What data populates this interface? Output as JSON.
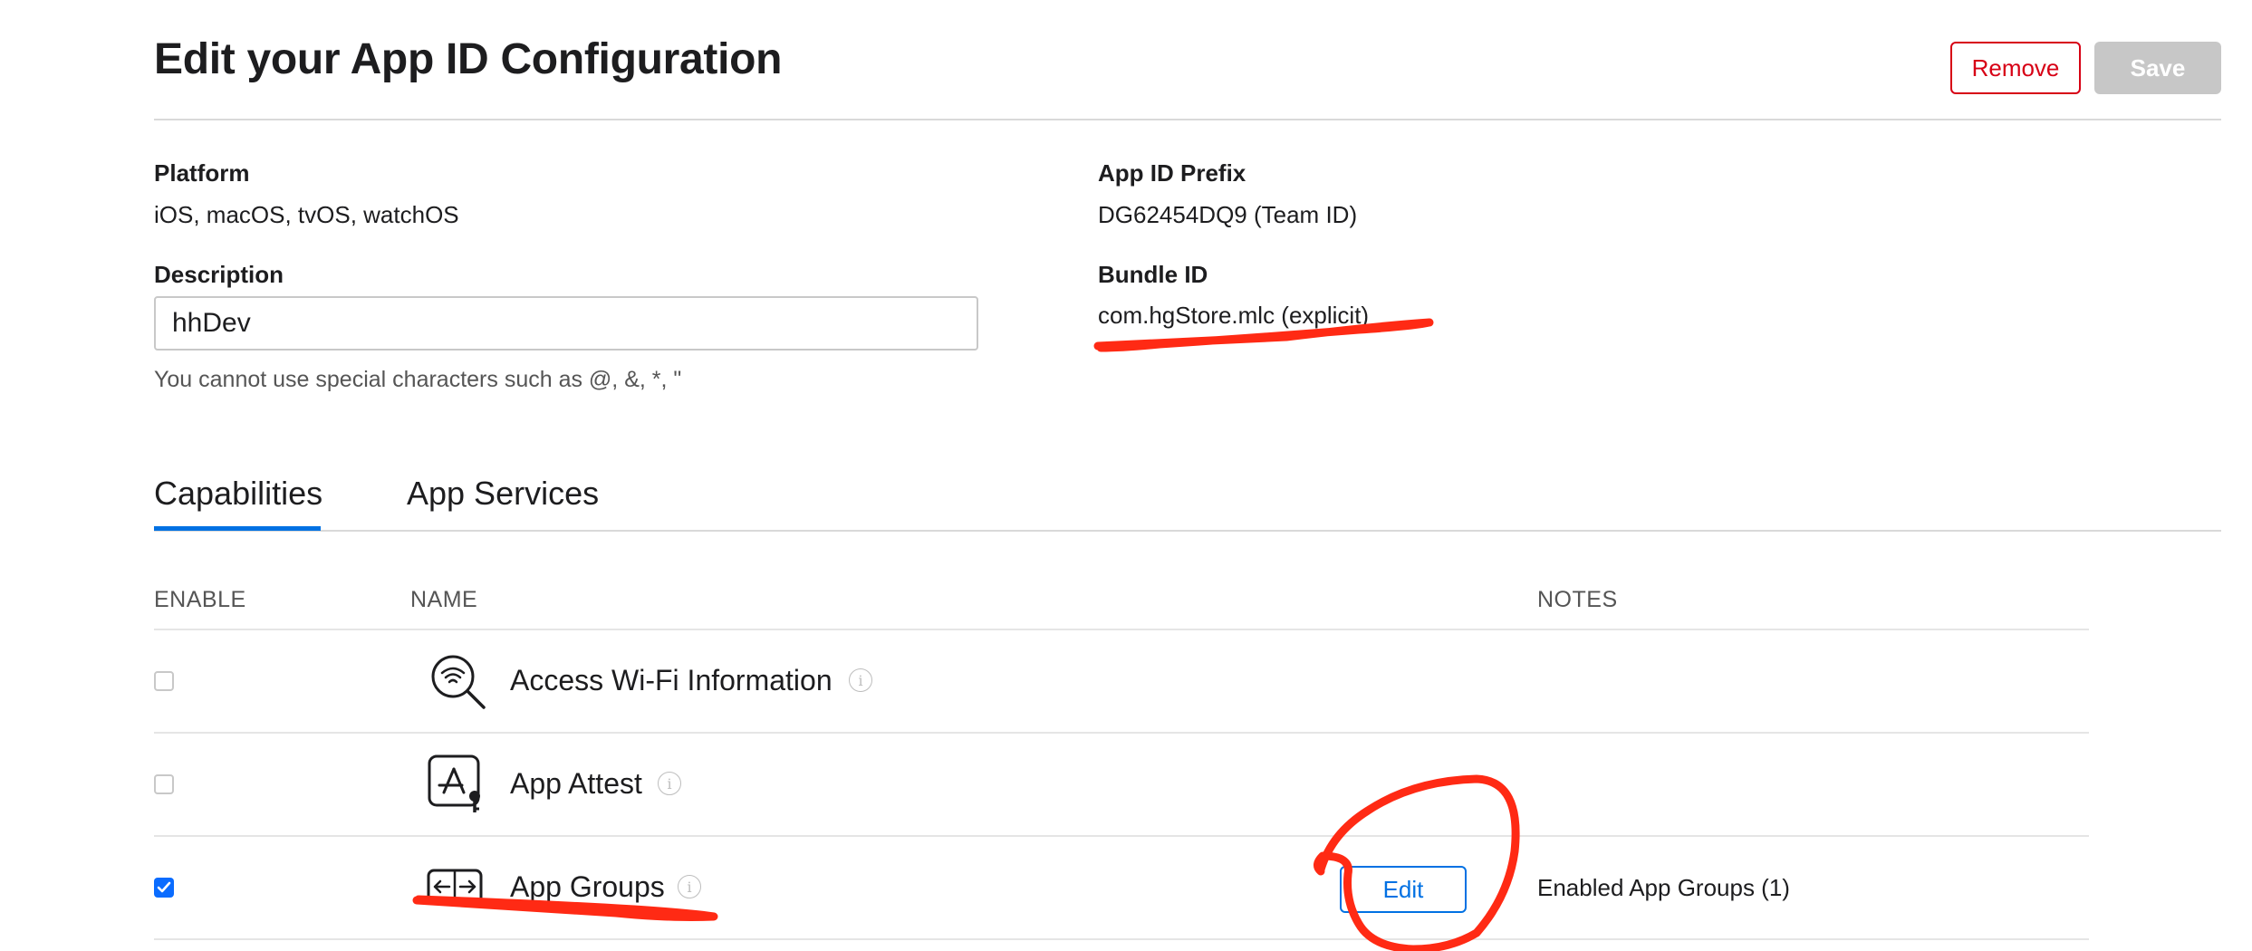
{
  "header": {
    "title": "Edit your App ID Configuration",
    "remove_label": "Remove",
    "save_label": "Save"
  },
  "details": {
    "platform_label": "Platform",
    "platform_value": "iOS, macOS, tvOS, watchOS",
    "prefix_label": "App ID Prefix",
    "prefix_value": "DG62454DQ9 (Team ID)",
    "description_label": "Description",
    "description_value": "hhDev",
    "description_hint": "You cannot use special characters such as @, &, *, \"",
    "bundle_label": "Bundle ID",
    "bundle_value": "com.hgStore.mlc (explicit)"
  },
  "tabs": [
    {
      "label": "Capabilities",
      "active": true
    },
    {
      "label": "App Services",
      "active": false
    }
  ],
  "table": {
    "columns": [
      "ENABLE",
      "NAME",
      "NOTES"
    ],
    "rows": [
      {
        "name": "Access Wi-Fi Information",
        "icon": "wifi-search-icon",
        "enabled": false,
        "edit": "",
        "note": ""
      },
      {
        "name": "App Attest",
        "icon": "app-attest-icon",
        "enabled": false,
        "edit": "",
        "note": ""
      },
      {
        "name": "App Groups",
        "icon": "app-groups-icon",
        "enabled": true,
        "edit": "Edit",
        "note": "Enabled App Groups (1)"
      }
    ]
  },
  "colors": {
    "accent": "#0071e3",
    "danger": "#d70015",
    "annotation": "#ff2a14",
    "disabled": "#c7c7c7"
  }
}
